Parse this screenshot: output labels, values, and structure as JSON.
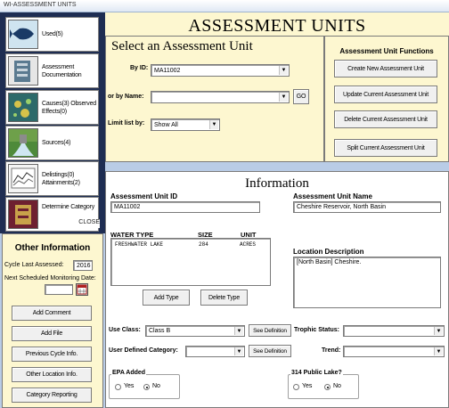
{
  "window": {
    "title": "WI-ASSESSMENT UNITS"
  },
  "sidebar": {
    "items": [
      {
        "label": "Used(5)",
        "icon": "fish-icon"
      },
      {
        "label": "Assessment Documentation",
        "icon": "document-stack-icon"
      },
      {
        "label": "Causes(3) Observed Effects(0)",
        "icon": "microbe-icon"
      },
      {
        "label": "Sources(4)",
        "icon": "outfall-pipe-icon"
      },
      {
        "label": "Delistings(0) Attainments(2)",
        "icon": "chart-paper-icon"
      },
      {
        "label": "Determine Category",
        "icon": "file-box-icon"
      }
    ],
    "close_label": "CLOSE"
  },
  "other_info": {
    "title": "Other Information",
    "cycle_label": "Cycle Last Assessed:",
    "cycle_value": "2016",
    "next_label": "Next Scheduled Monitoring Date:",
    "next_value": "",
    "buttons": [
      "Add Comment",
      "Add File",
      "Previous Cycle Info.",
      "Other Location Info.",
      "Category Reporting"
    ]
  },
  "header": {
    "title": "ASSESSMENT UNITS"
  },
  "select": {
    "title": "Select an Assessment Unit",
    "by_id_label": "By ID:",
    "by_id_value": "MA11002",
    "by_name_label": "or by Name:",
    "by_name_value": "",
    "go_label": "GO",
    "limit_label": "Limit list by:",
    "limit_value": "Show All"
  },
  "functions": {
    "title": "Assessment Unit Functions",
    "buttons": [
      "Create New Assessment Unit",
      "Update Current Assessment Unit",
      "Delete Current Assessment Unit",
      "Split Current Assessment Unit"
    ]
  },
  "info": {
    "title": "Information",
    "au_id_label": "Assessment Unit ID",
    "au_id_value": "MA11002",
    "au_name_label": "Assessment Unit Name",
    "au_name_value": "Cheshire Reservoir, North Basin",
    "water_headers": [
      "WATER TYPE",
      "SIZE",
      "UNIT"
    ],
    "water_rows": [
      [
        "FRESHWATER LAKE",
        "284",
        "ACRES"
      ]
    ],
    "location_label": "Location Description",
    "location_value": "[North Basin] Cheshire.",
    "add_type_label": "Add Type",
    "delete_type_label": "Delete Type",
    "use_class_label": "Use Class:",
    "use_class_value": "Class B",
    "see_definition_label": "See Definition",
    "trophic_label": "Trophic Status:",
    "trophic_value": "",
    "user_cat_label": "User Defined Category:",
    "user_cat_value": "",
    "trend_label": "Trend:",
    "trend_value": "",
    "epa_label": "EPA Added",
    "public_lake_label": "314 Public Lake?",
    "yes_label": "Yes",
    "no_label": "No",
    "epa_selected": "No",
    "public_lake_selected": "No"
  }
}
